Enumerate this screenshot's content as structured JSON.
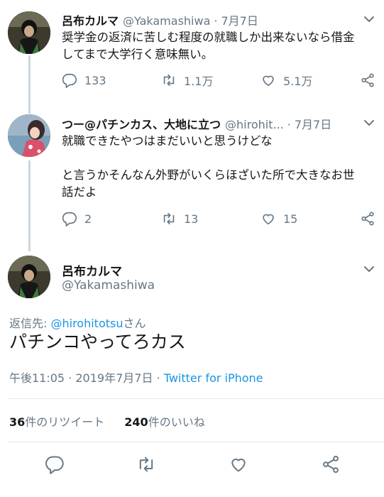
{
  "tweets": [
    {
      "name": "呂布カルマ",
      "handle": "@Yakamashiwa",
      "separator": "·",
      "date": "7月7日",
      "avatar": "avatar-rapper-icon",
      "text_lines": [
        "奨学金の返済に苦しむ程度の就職しか出来ないなら借金",
        "してまで大学行く意味無い。"
      ],
      "replies": "133",
      "retweets": "1.1万",
      "likes": "5.1万"
    },
    {
      "name": "つー@パチンカス、大地に立つ",
      "handle": "@hirohit...",
      "separator": "·",
      "date": "7月7日",
      "avatar": "avatar-anime-icon",
      "text_lines": [
        "就職できたやつはまだいいと思うけどな",
        "",
        "と言うかそんなん外野がいくらほざいた所で大きなお世",
        "話だよ"
      ],
      "replies": "2",
      "retweets": "13",
      "likes": "15"
    }
  ],
  "main_tweet": {
    "name": "呂布カルマ",
    "handle": "@Yakamashiwa",
    "reply_prefix": "返信先: ",
    "reply_mention": "@hirohitotsu",
    "reply_suffix": "さん",
    "text": "パチンコやってろカス",
    "time": "午後11:05 · 2019年7月7日 · ",
    "source": "Twitter for iPhone",
    "retweet_count": "36",
    "retweet_label": "件のリツイート",
    "like_count": "240",
    "like_label": "件のいいね"
  },
  "colors": {
    "link": "#1b95e0",
    "muted": "#657786",
    "text": "#14171a",
    "divider": "#e1e8ed"
  }
}
